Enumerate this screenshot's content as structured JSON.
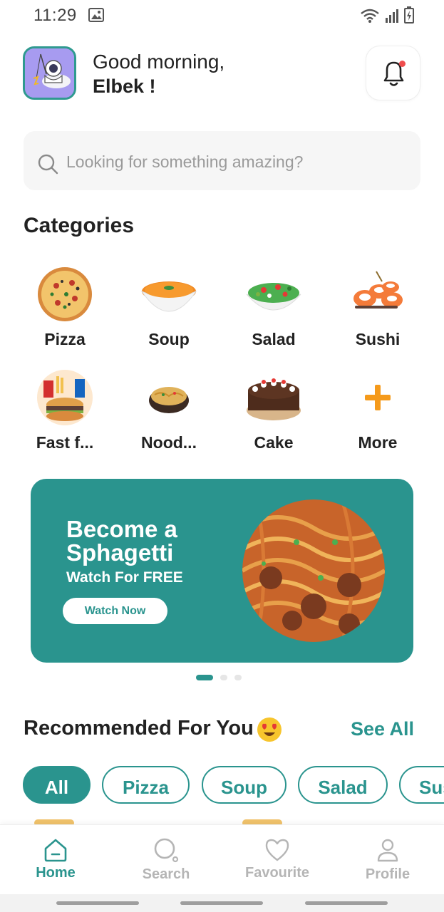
{
  "status_bar": {
    "time": "11:29"
  },
  "header": {
    "greeting": "Good morning,",
    "user_name": "Elbek !"
  },
  "search": {
    "placeholder": "Looking for something amazing?"
  },
  "categories": {
    "title": "Categories",
    "items": [
      {
        "label": "Pizza",
        "icon": "pizza-icon"
      },
      {
        "label": "Soup",
        "icon": "soup-icon"
      },
      {
        "label": "Salad",
        "icon": "salad-icon"
      },
      {
        "label": "Sushi",
        "icon": "sushi-icon"
      },
      {
        "label": "Fast f...",
        "icon": "fast-food-icon"
      },
      {
        "label": "Nood...",
        "icon": "noodles-icon"
      },
      {
        "label": "Cake",
        "icon": "cake-icon"
      },
      {
        "label": "More",
        "icon": "plus-icon"
      }
    ]
  },
  "banner": {
    "title_line1": "Become a",
    "title_line2": "Sphagetti",
    "subtitle": "Watch For FREE",
    "button_label": "Watch Now",
    "active_slide": 1,
    "slide_count": 3
  },
  "recommended": {
    "title": "Recommended For You",
    "see_all": "See All",
    "filters": [
      "All",
      "Pizza",
      "Soup",
      "Salad",
      "Sus"
    ],
    "active_filter": "All"
  },
  "bottom_nav": {
    "items": [
      {
        "label": "Home",
        "icon": "home-icon",
        "active": true
      },
      {
        "label": "Search",
        "icon": "search-icon",
        "active": false
      },
      {
        "label": "Favourite",
        "icon": "heart-icon",
        "active": false
      },
      {
        "label": "Profile",
        "icon": "profile-icon",
        "active": false
      }
    ]
  },
  "colors": {
    "accent": "#2a948e",
    "notification_dot": "#ef4d4d",
    "plus_orange": "#f59a1b"
  }
}
